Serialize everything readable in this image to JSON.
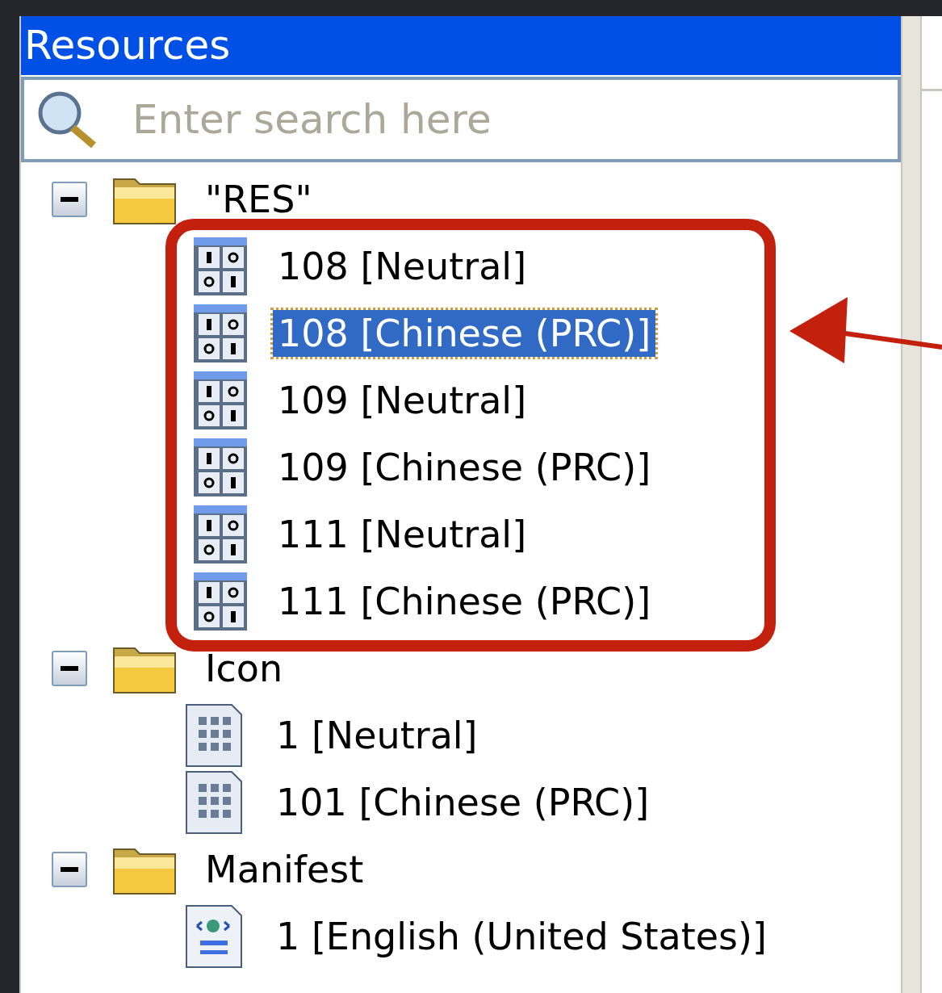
{
  "panel": {
    "title": "Resources"
  },
  "search": {
    "placeholder": "Enter search here"
  },
  "tree": [
    {
      "label": "\"RES\"",
      "expanded": true,
      "children": [
        {
          "label": "108 [Neutral]",
          "kind": "dialog",
          "selected": false
        },
        {
          "label": "108 [Chinese (PRC)]",
          "kind": "dialog",
          "selected": true
        },
        {
          "label": "109 [Neutral]",
          "kind": "dialog",
          "selected": false
        },
        {
          "label": "109 [Chinese (PRC)]",
          "kind": "dialog",
          "selected": false
        },
        {
          "label": "111 [Neutral]",
          "kind": "dialog",
          "selected": false
        },
        {
          "label": "111 [Chinese (PRC)]",
          "kind": "dialog",
          "selected": false
        }
      ]
    },
    {
      "label": "Icon",
      "expanded": true,
      "children": [
        {
          "label": "1 [Neutral]",
          "kind": "icon",
          "selected": false
        },
        {
          "label": "101 [Chinese (PRC)]",
          "kind": "icon",
          "selected": false
        }
      ]
    },
    {
      "label": "Manifest",
      "expanded": true,
      "children": [
        {
          "label": "1 [English (United States)]",
          "kind": "manifest",
          "selected": false
        }
      ]
    }
  ]
}
